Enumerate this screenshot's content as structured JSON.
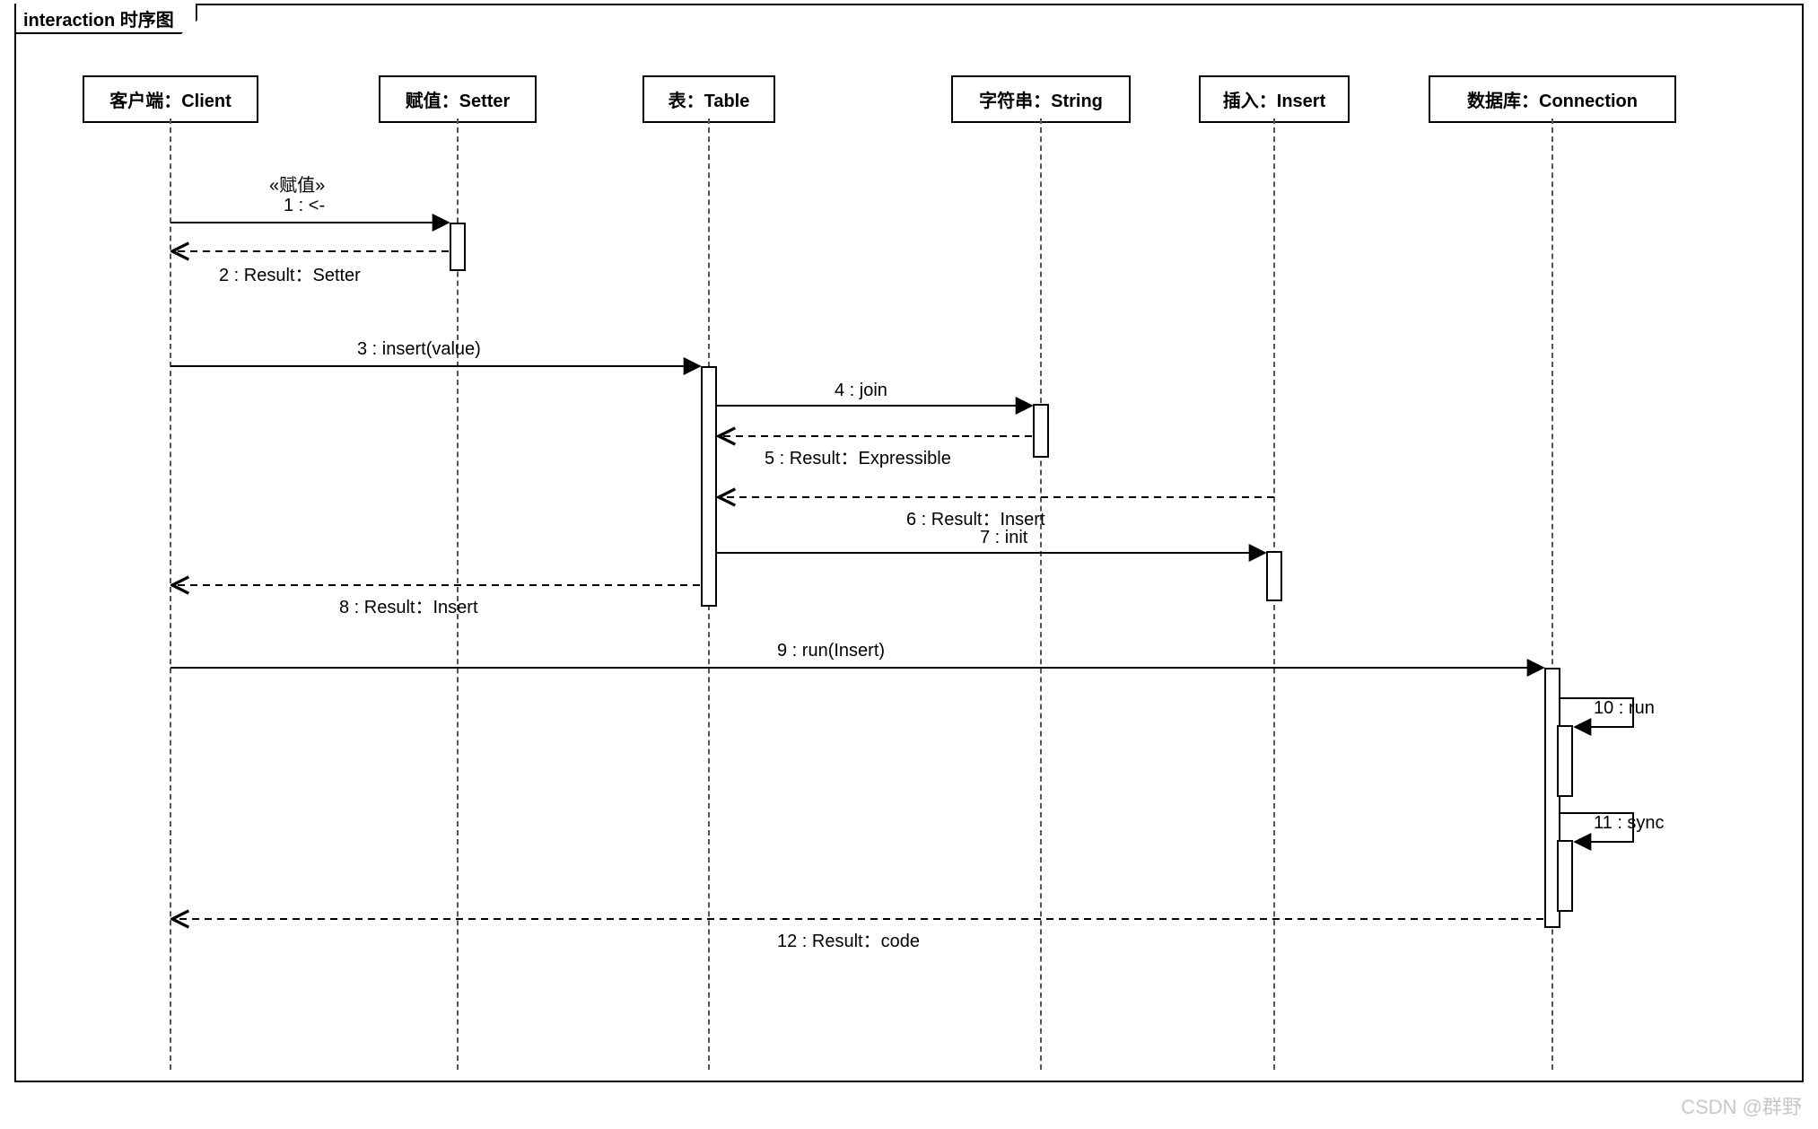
{
  "frame": {
    "title": "interaction 时序图"
  },
  "participants": {
    "client": {
      "label": "客户端：Client"
    },
    "setter": {
      "label": "赋值：Setter"
    },
    "table": {
      "label": "表：Table"
    },
    "string": {
      "label": "字符串：String"
    },
    "insert": {
      "label": "插入：Insert"
    },
    "connection": {
      "label": "数据库：Connection"
    }
  },
  "messages": {
    "m1_stereo": "«赋值»",
    "m1": "1 : <-",
    "m2": "2 : Result：Setter",
    "m3": "3 : insert(value)",
    "m4": "4 : join",
    "m5": "5 : Result：Expressible",
    "m6": "6 : Result：Insert",
    "m7": "7 : init",
    "m8": "8 : Result：Insert",
    "m9": "9 : run(Insert)",
    "m10": "10 : run",
    "m11": "11 : sync",
    "m12": "12 : Result：code"
  },
  "watermark": "CSDN @群野"
}
